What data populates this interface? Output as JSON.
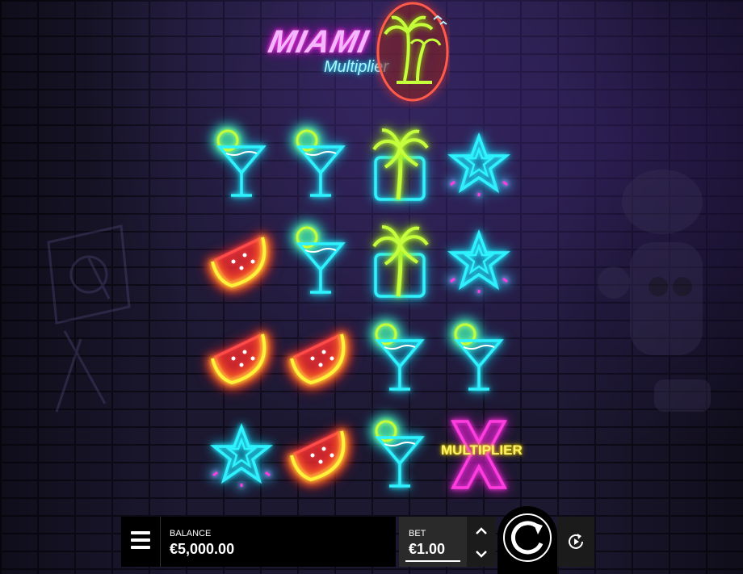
{
  "game": {
    "logo_title": "MIAMI",
    "logo_subtitle": "Multiplier"
  },
  "reels": [
    [
      "martini",
      "watermelon",
      "watermelon",
      "star"
    ],
    [
      "martini",
      "martini",
      "watermelon",
      "watermelon"
    ],
    [
      "palm-tree",
      "palm-tree",
      "martini",
      "martini"
    ],
    [
      "star",
      "star",
      "martini",
      "multiplier"
    ]
  ],
  "multiplier_label": "MULTIPLIER",
  "hud": {
    "balance_label": "BALANCE",
    "balance_value": "€5,000.00",
    "bet_label": "BET",
    "bet_value": "€1.00"
  },
  "icons": {
    "menu": "hamburger-menu-icon",
    "bet_up": "chevron-up-icon",
    "bet_down": "chevron-down-icon",
    "spin": "spin-arrow-icon",
    "autoplay": "autoplay-icon"
  },
  "colors": {
    "neon_cyan": "#2ef3ff",
    "neon_green": "#c5ff3c",
    "neon_red": "#ff4a4a",
    "neon_pink": "#ff3ce0",
    "neon_yellow": "#fff23a",
    "panel_black": "#000000",
    "bet_panel": "#2a2a2a"
  }
}
